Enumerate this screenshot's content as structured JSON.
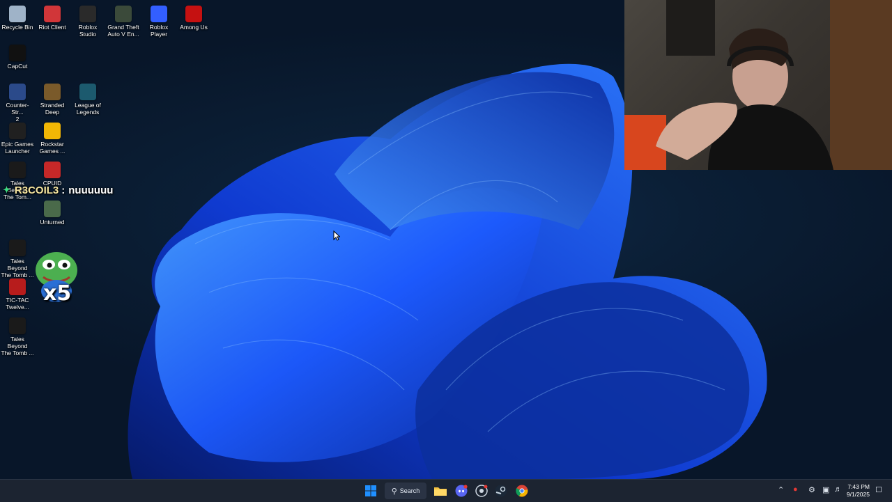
{
  "desktop": {
    "icons": [
      {
        "label": "Recycle Bin",
        "icon": "recycle-bin-icon",
        "color": "#9fb3c8"
      },
      {
        "label": "Riot Client",
        "icon": "riot-client-icon",
        "color": "#d13639"
      },
      {
        "label": "Roblox\nStudio",
        "icon": "roblox-studio-icon",
        "color": "#2a2a2a"
      },
      {
        "label": "Grand Theft\nAuto V En...",
        "icon": "gta-v-icon",
        "color": "#3b4a3a"
      },
      {
        "label": "Roblox Player",
        "icon": "roblox-player-icon",
        "color": "#335fff"
      },
      {
        "label": "Among Us",
        "icon": "among-us-icon",
        "color": "#c51111"
      },
      {
        "label": "CapCut",
        "icon": "capcut-icon",
        "color": "#111111"
      },
      {
        "label": "Counter-Str...\n2",
        "icon": "counter-strike-icon",
        "color": "#2b4a8a"
      },
      {
        "label": "Stranded\nDeep",
        "icon": "stranded-deep-icon",
        "color": "#7a5a2a"
      },
      {
        "label": "League of\nLegends",
        "icon": "league-of-legends-icon",
        "color": "#1c5a6e"
      },
      {
        "label": "Epic Games\nLauncher",
        "icon": "epic-games-icon",
        "color": "#202020"
      },
      {
        "label": "Rockstar\nGames ...",
        "icon": "rockstar-games-icon",
        "color": "#f2b705"
      },
      {
        "label": "Tales Beyond\nThe Tom...",
        "icon": "tbtt-icon",
        "color": "#1a1a1a"
      },
      {
        "label": "CPUID",
        "icon": "cpuid-icon",
        "color": "#c62828"
      },
      {
        "label": "Unturned",
        "icon": "unturned-icon",
        "color": "#4a6a4a"
      },
      {
        "label": "Tales Beyond\nThe Tomb ...",
        "icon": "tbtt-2-icon",
        "color": "#1a1a1a"
      },
      {
        "label": "TIC-TAC\nTwelve...",
        "icon": "tic-tac-icon",
        "color": "#b71c1c"
      },
      {
        "label": "Tales Beyond\nThe Tomb ...",
        "icon": "tbtt-3-icon",
        "color": "#1a1a1a"
      }
    ]
  },
  "chat": {
    "user": "R3COIL3",
    "separator": ":",
    "message": "nuuuuuu",
    "emote_multiplier": "x5"
  },
  "taskbar": {
    "search_label": "Search",
    "clock_time": "7:43 PM",
    "clock_date": "9/1/2025",
    "accent": "#1f8fff"
  }
}
